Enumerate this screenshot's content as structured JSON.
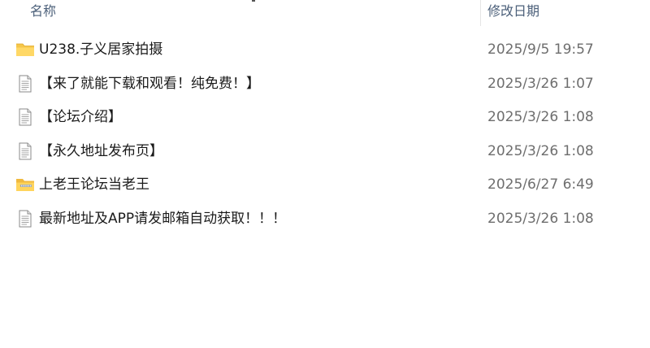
{
  "columns": {
    "name": "名称",
    "date": "修改日期"
  },
  "files": [
    {
      "icon": "folder-icon",
      "name": "U238.子义居家拍摄",
      "date": "2025/9/5 19:57"
    },
    {
      "icon": "document-icon",
      "name": "【来了就能下载和观看！纯免费！】",
      "date": "2025/3/26 1:07"
    },
    {
      "icon": "document-icon",
      "name": "【论坛介绍】",
      "date": "2025/3/26 1:08"
    },
    {
      "icon": "document-icon",
      "name": "【永久地址发布页】",
      "date": "2025/3/26 1:08"
    },
    {
      "icon": "zip-folder-icon",
      "name": "上老王论坛当老王",
      "date": "2025/6/27 6:49"
    },
    {
      "icon": "document-icon",
      "name": "最新地址及APP请发邮箱自动获取！！！",
      "date": "2025/3/26 1:08"
    }
  ]
}
